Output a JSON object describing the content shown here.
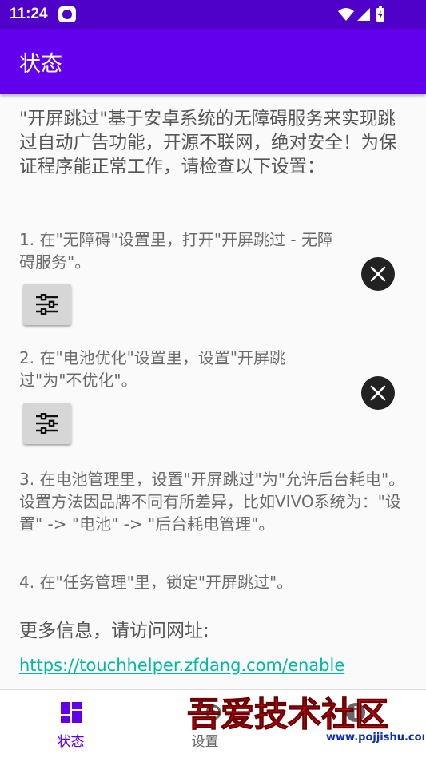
{
  "status_bar": {
    "time": "11:24"
  },
  "app_bar": {
    "title": "状态"
  },
  "intro": "\"开屏跳过\"基于安卓系统的无障碍服务来实现跳过自动广告功能，开源不联网，绝对安全！为保证程序能正常工作，请检查以下设置：",
  "steps": [
    {
      "text": "1. 在\"无障碍\"设置里，打开\"开屏跳过 - 无障碍服务\"。"
    },
    {
      "text": "2. 在\"电池优化\"设置里，设置\"开屏跳过\"为\"不优化\"。"
    },
    {
      "text": "3. 在电池管理里，设置\"开屏跳过\"为\"允许后台耗电\"。设置方法因品牌不同有所差异，比如VIVO系统为：\"设置\" -> \"电池\" -> \"后台耗电管理\"。"
    },
    {
      "text": "4. 在\"任务管理\"里，锁定\"开屏跳过\"。"
    }
  ],
  "more_info": "更多信息，请访问网址:",
  "link": "https://touchhelper.zfdang.com/enable",
  "bottom_nav": [
    {
      "label": "状态",
      "icon": "dashboard-icon",
      "active": true
    },
    {
      "label": "设置",
      "icon": "settings-icon",
      "active": false
    },
    {
      "label": "",
      "icon": "info-icon",
      "active": false
    }
  ],
  "watermark": {
    "text": "吾爱技术社区",
    "url": "www.pojjishu.com"
  },
  "colors": {
    "primary": "#6200ee",
    "status_bar": "#4f00c9",
    "accent_link": "#00b9a0",
    "nav_active": "#6200ee",
    "nav_inactive": "#666666"
  }
}
